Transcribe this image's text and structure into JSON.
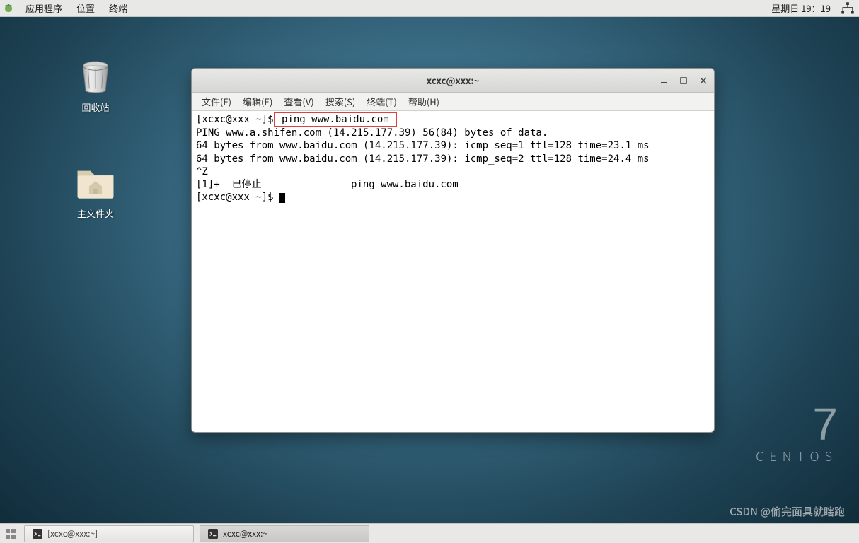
{
  "top_panel": {
    "apps": "应用程序",
    "places": "位置",
    "terminal": "终端",
    "clock": "星期日 19：19"
  },
  "desktop": {
    "trash": "回收站",
    "home": "主文件夹"
  },
  "branding": {
    "version": "7",
    "name": "CENTOS"
  },
  "window": {
    "title": "xcxc@xxx:~",
    "menu": {
      "file": "文件(F)",
      "edit": "编辑(E)",
      "view": "查看(V)",
      "search": "搜索(S)",
      "terminal": "终端(T)",
      "help": "帮助(H)"
    },
    "terminal": {
      "prompt1_pre": "[xcxc@xxx ~]$",
      "cmd1": " ping www.baidu.com ",
      "l2": "PING www.a.shifen.com (14.215.177.39) 56(84) bytes of data.",
      "l3": "64 bytes from www.baidu.com (14.215.177.39): icmp_seq=1 ttl=128 time=23.1 ms",
      "l4": "64 bytes from www.baidu.com (14.215.177.39): icmp_seq=2 ttl=128 time=24.4 ms",
      "l5": "^Z",
      "l6": "[1]+  已停止               ping www.baidu.com",
      "prompt2": "[xcxc@xxx ~]$ "
    }
  },
  "taskbar": {
    "task1": "[xcxc@xxx:~]",
    "task2": "xcxc@xxx:~"
  },
  "watermark": "CSDN @偷完面具就瞎跑"
}
